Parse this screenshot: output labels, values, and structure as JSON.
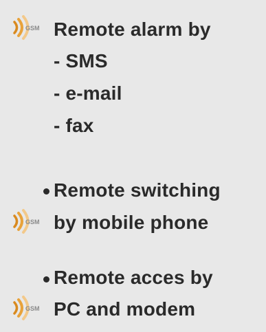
{
  "features": [
    {
      "bullet": false,
      "icon": "gsm-signal-icon",
      "lines": [
        "Remote alarm by",
        "- SMS",
        "- e-mail",
        "- fax"
      ]
    },
    {
      "bullet": true,
      "icon": "gsm-signal-icon",
      "lines": [
        "Remote switching",
        "by mobile phone"
      ]
    },
    {
      "bullet": true,
      "icon": "gsm-signal-icon",
      "lines": [
        "Remote acces by",
        "PC and modem"
      ]
    }
  ],
  "icon_label": "GSM",
  "colors": {
    "background": "#e8e8e8",
    "text": "#2a2a2a",
    "icon_arc": "#e8a23a",
    "icon_text": "#8a8a8a"
  }
}
